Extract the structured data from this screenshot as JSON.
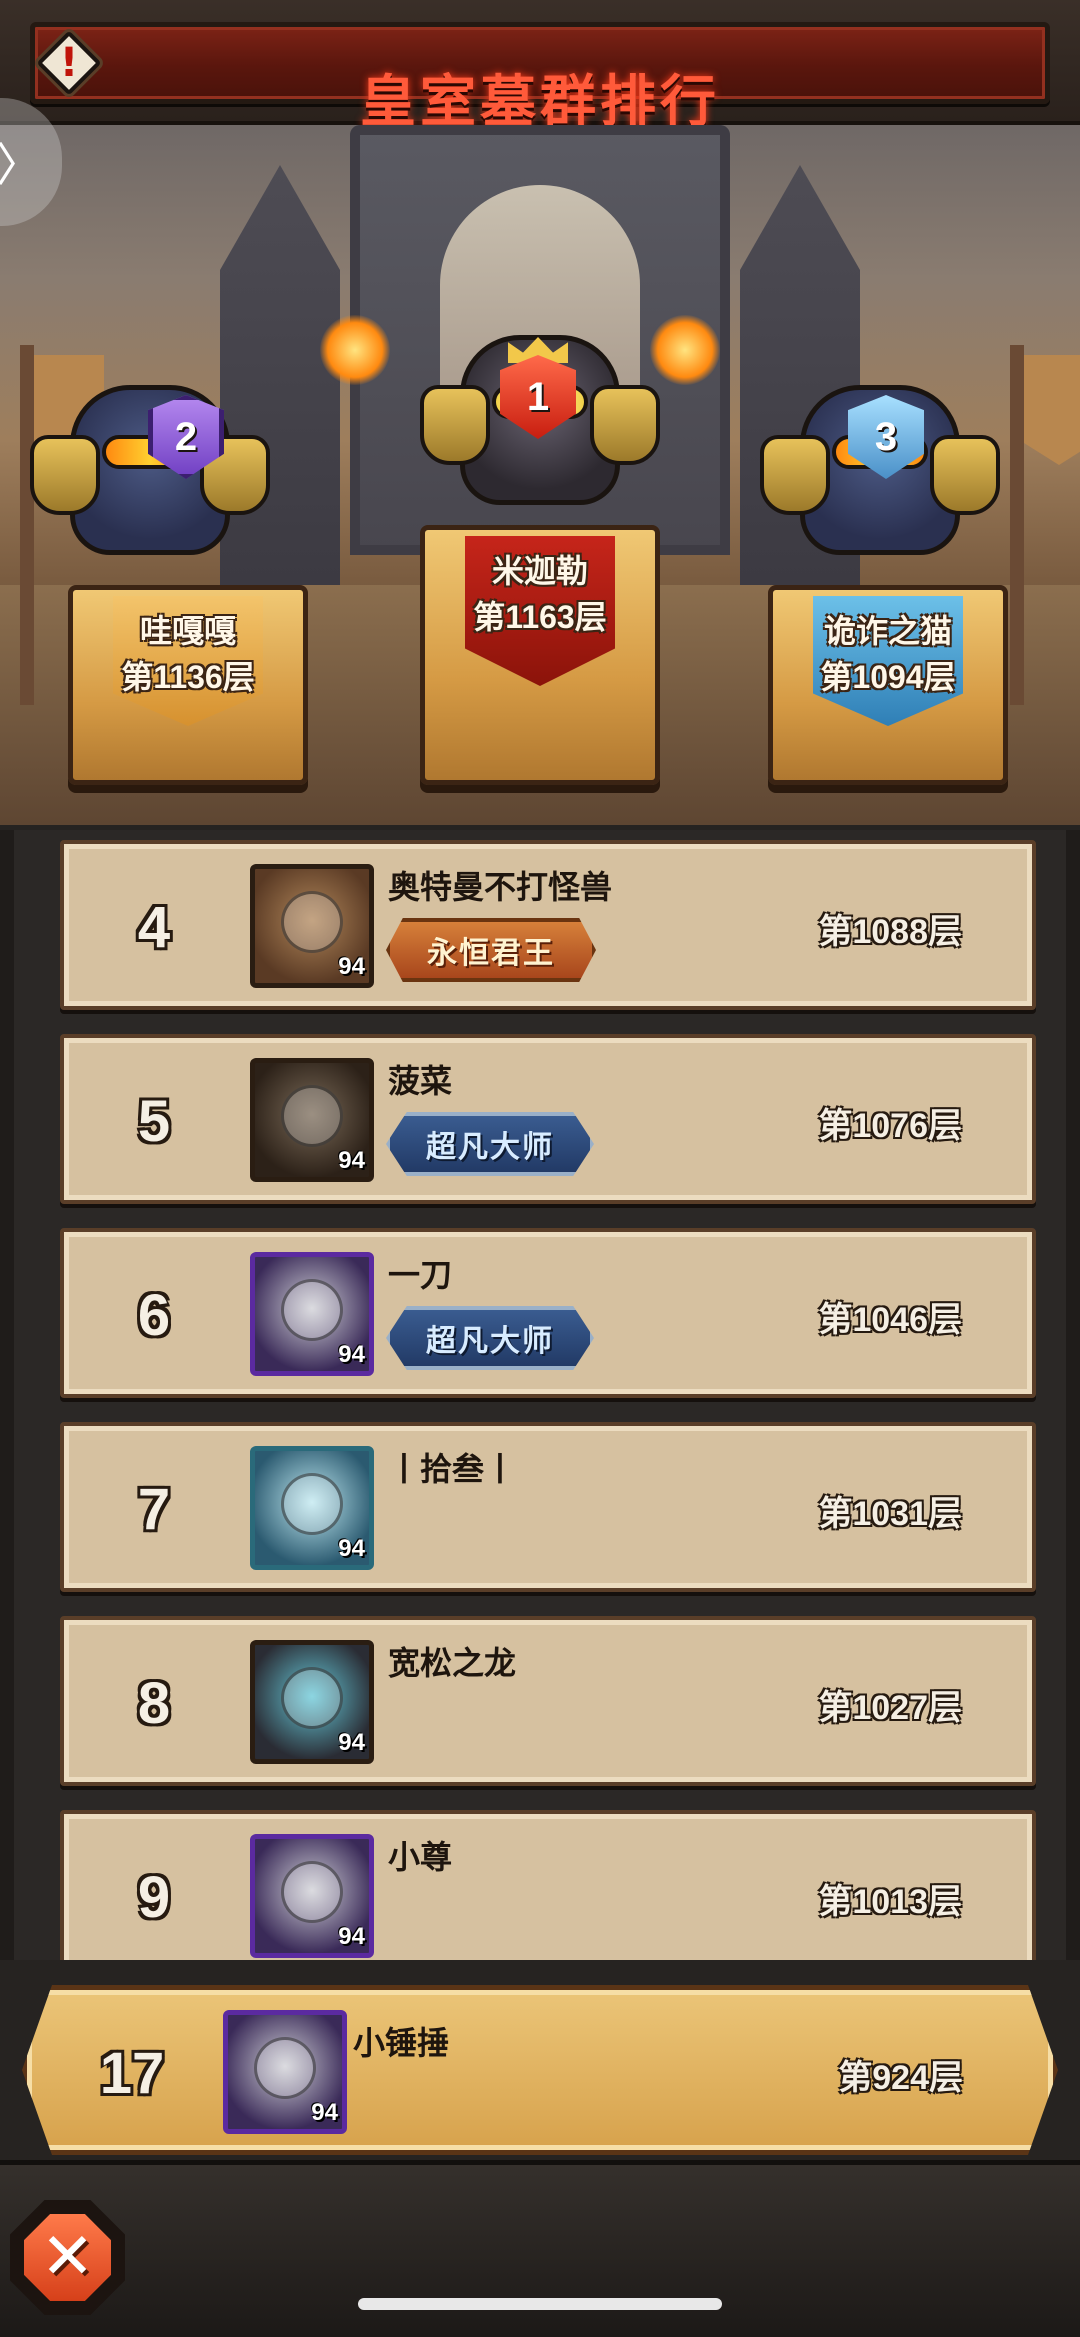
{
  "header": {
    "title": "皇室墓群排行",
    "info_icon": "exclamation-diamond-icon",
    "side_tab_icon": "chevron-right-icon",
    "side_tab_glyph": "〉"
  },
  "podium": [
    {
      "rank": "2",
      "name": "哇嘎嘎",
      "floor": "第1136层",
      "badge_color": "#8a52d8"
    },
    {
      "rank": "1",
      "name": "米迦勒",
      "floor": "第1163层",
      "badge_color": "#e03a22"
    },
    {
      "rank": "3",
      "name": "诡诈之猫",
      "floor": "第1094层",
      "badge_color": "#6ab4e4"
    }
  ],
  "ranking": [
    {
      "rank": "4",
      "name": "奥特曼不打怪兽",
      "level": "94",
      "title": "永恒君王",
      "title_type": "eternal",
      "floor": "第1088层"
    },
    {
      "rank": "5",
      "name": "菠菜",
      "level": "94",
      "title": "超凡大师",
      "title_type": "master",
      "floor": "第1076层"
    },
    {
      "rank": "6",
      "name": "一刀",
      "level": "94",
      "title": "超凡大师",
      "title_type": "master",
      "floor": "第1046层"
    },
    {
      "rank": "7",
      "name": "丨拾叁丨",
      "level": "94",
      "title": "",
      "floor": "第1031层"
    },
    {
      "rank": "8",
      "name": "宽松之龙",
      "level": "94",
      "title": "",
      "floor": "第1027层"
    },
    {
      "rank": "9",
      "name": "小尊",
      "level": "94",
      "title": "",
      "floor": "第1013层"
    }
  ],
  "my_rank": {
    "rank": "17",
    "name": "小锤捶",
    "level": "94",
    "floor": "第924层"
  },
  "footer": {
    "close_icon": "close-icon",
    "close_glyph": "✕"
  },
  "colors": {
    "title_red": "#ff5a3a",
    "row_bg": "#d6c1a0",
    "my_row_bg": "#ebc578",
    "close_orange": "#e8552a"
  }
}
